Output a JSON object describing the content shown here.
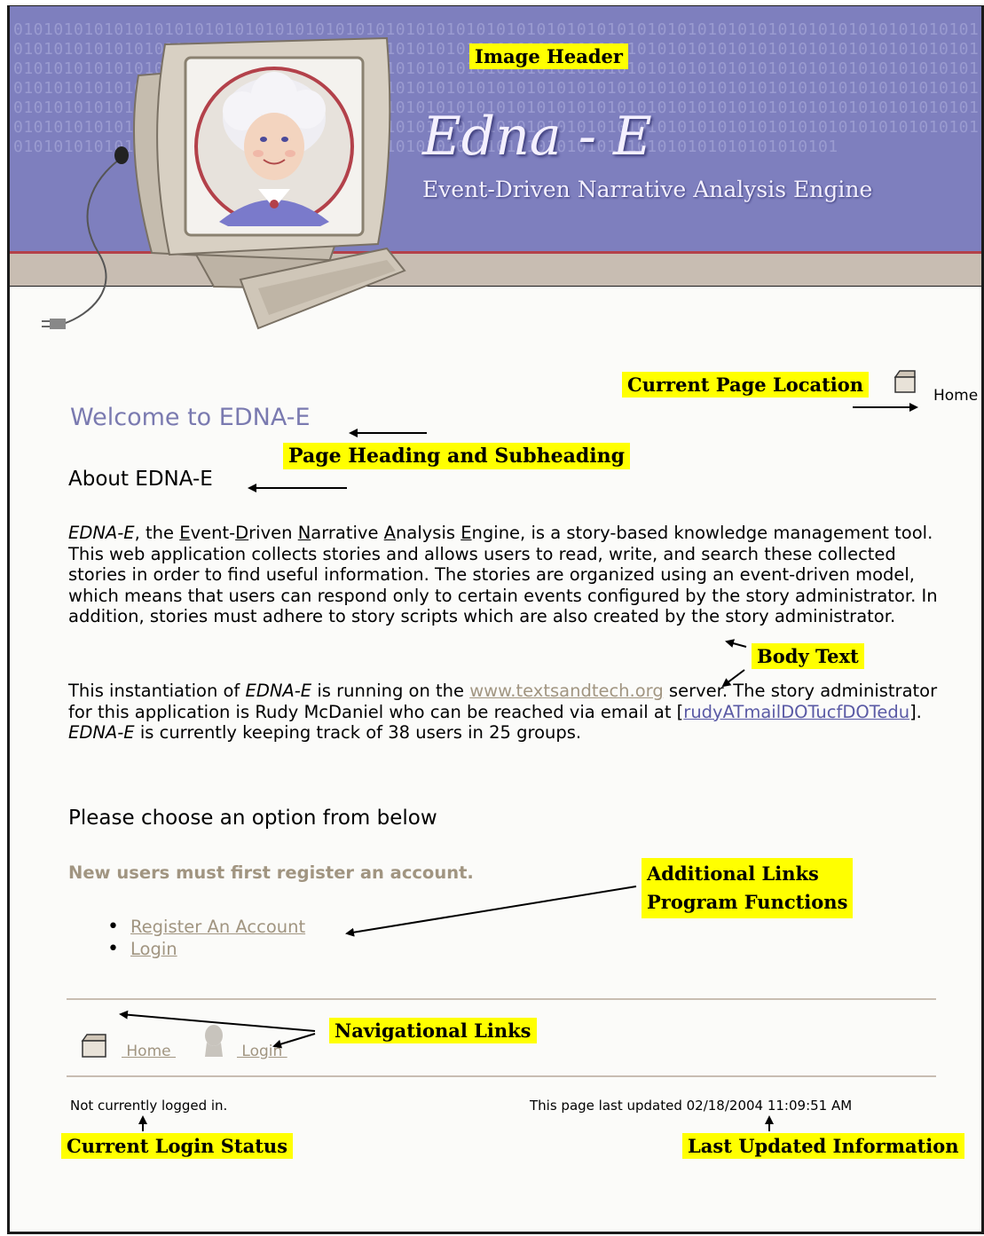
{
  "header": {
    "binary_pattern": "0101010101010101010101010101010101010101010101010101010101010101010101010101010101010101010101010101010101010101010101010101010101010101010101010101010101010101010101010101010101010101010101010101010101010101010101010101010101010101010101010101010101010101010101010101010101010101010101010101010101010101010101010101010101010101010101010101010101010101010101010101010101010101010101010101010101010101010101010101010101010101010101010101010101010101010101010101010101010101010101010101010101010101010101010101010101010101010101010101010101010101010101010101010101010101010101010101010101010101010101010101010101010101010101010101010101010101010101010101010101",
    "logo_title": "Edna - E",
    "logo_subtitle": "Event-Driven Narrative Analysis Engine",
    "image": "edna-mascot-computer-icon"
  },
  "annotations": {
    "image_header": "Image Header",
    "current_page_location": "Current Page Location",
    "page_heading_and_subheading": "Page Heading and Subheading",
    "body_text": "Body Text",
    "additional_links_line1": "Additional Links",
    "additional_links_line2": "Program Functions",
    "navigational_links": "Navigational Links",
    "current_login_status": "Current Login Status",
    "last_updated_information": "Last Updated Information",
    "highlight_color": "#ffff00"
  },
  "location": {
    "icon": "home-icon",
    "label": "Home"
  },
  "content": {
    "page_heading": "Welcome to EDNA-E",
    "sub_heading": "About EDNA-E",
    "intro": {
      "edna_e": "EDNA-E",
      "the": ", the ",
      "event_e": "E",
      "event_rest": "vent-",
      "driven_d": "D",
      "driven_rest": "riven ",
      "narrative_n": "N",
      "narrative_rest": "arrative ",
      "analysis_a": "A",
      "analysis_rest": "nalysis ",
      "engine_e": "E",
      "rest": "ngine, is a story-based knowledge management tool. This web application collects stories and allows users to read, write, and search these collected stories in order to find useful information. The stories are organized using an event-driven model, which means that users can respond only to certain events configured by the story administrator. In addition, stories must adhere to story scripts which are also created by the story administrator."
    },
    "server": {
      "part1": "This instantiation of ",
      "edna_e": "EDNA-E",
      "part2": " is running on the ",
      "server_link": "www.textsandtech.org",
      "part3": " server. The story administrator for this application is Rudy McDaniel who can be reached via email at [",
      "email_link": "rudyATmailDOTucfDOTedu",
      "part4": "]. ",
      "edna_e2": "EDNA-E",
      "part5": " is currently keeping track of 38 users in 25 groups."
    },
    "choose_heading": "Please choose an option from below",
    "new_users_note": "New users must first register an account.",
    "options": [
      {
        "label": "Register An Account"
      },
      {
        "label": "Login"
      }
    ]
  },
  "nav": {
    "home_icon": "home-icon",
    "home_label": " Home ",
    "login_icon": "user-silhouette-icon",
    "login_label": " Login "
  },
  "footer": {
    "login_status": "Not currently logged in.",
    "last_updated": "This page last updated 02/18/2004 11:09:51 AM"
  },
  "colors": {
    "header_blue": "#7e7fbe",
    "header_red_line": "#b3414a",
    "tan_accent": "#a19581",
    "heading_purple": "#7a7ab0",
    "link_blue": "#5a5aa5"
  }
}
